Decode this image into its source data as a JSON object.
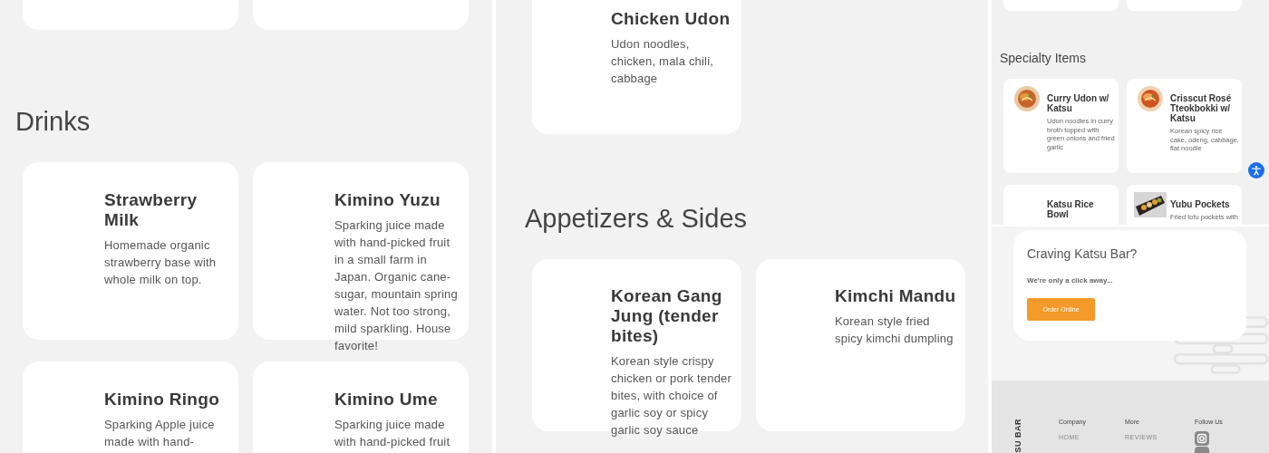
{
  "drinks_page": {
    "heading": "Drinks",
    "items": [
      {
        "name": "Strawberry Milk",
        "description": "Homemade organic strawberry base with whole milk on top."
      },
      {
        "name": "Kimino Yuzu",
        "description": "Sparking juice made with hand-picked fruit in a small farm in Japan. Organic cane-sugar, mountain spring water. Not too strong, mild sparkling. House favorite!"
      },
      {
        "name": "Kimino Ringo",
        "description": "Sparking Apple juice made with hand-"
      },
      {
        "name": "Kimino Ume",
        "description": "Sparking juice made with hand-picked fruit"
      }
    ]
  },
  "noodles_page": {
    "top_item": {
      "name": "Chicken Udon",
      "description": "Udon noodles, chicken, mala chili, cabbage"
    },
    "heading": "Appetizers & Sides",
    "items": [
      {
        "name": "Korean Gang Jung (tender bites)",
        "description": "Korean style crispy chicken or pork tender bites, with choice of garlic soy or spicy garlic soy sauce"
      },
      {
        "name": "Kimchi Mandu",
        "description": "Korean style fried spicy kimchi dumpling"
      }
    ]
  },
  "specialty_page": {
    "heading": "Specialty Items",
    "items": [
      {
        "name": "Curry Udon w/ Katsu",
        "description": "Udon noodles in curry broth topped with green onions and fried garlic",
        "kind": "picture"
      },
      {
        "name": "Crisscut Rosé Tteokbokki w/ Katsu",
        "description": "Korean spicy rice cake, odeng, cabbage, flat noodle",
        "kind": "picture"
      },
      {
        "name": "Katsu Rice Bowl"
      },
      {
        "name": "Yubu Pockets",
        "description": "Fried tofu pockets with",
        "kind": "picture"
      }
    ],
    "cta": {
      "title": "Craving Katsu Bar?",
      "subtitle": "We're only a click away...",
      "button": "Order Online"
    },
    "footer": {
      "brand": "SU BAR",
      "columns": [
        {
          "heading": "Company",
          "links": [
            "HOME"
          ]
        },
        {
          "heading": "More",
          "links": [
            "REVIEWS"
          ]
        },
        {
          "heading": "Follow Us",
          "social": true
        }
      ]
    }
  }
}
